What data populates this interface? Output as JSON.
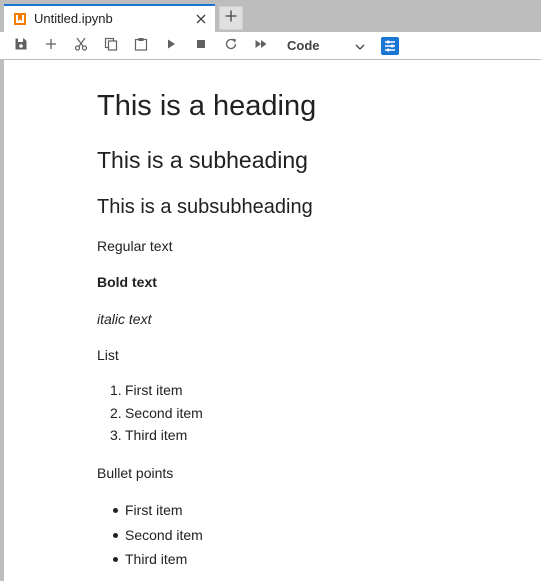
{
  "tab": {
    "title": "Untitled.ipynb",
    "icon": "notebook-icon",
    "accent_color": "#1976d2",
    "icon_color": "#f57c00"
  },
  "toolbar": {
    "buttons": [
      {
        "icon": "save-icon"
      },
      {
        "icon": "add-cell-icon"
      },
      {
        "icon": "cut-icon"
      },
      {
        "icon": "copy-icon"
      },
      {
        "icon": "paste-icon"
      },
      {
        "icon": "run-icon"
      },
      {
        "icon": "stop-icon"
      },
      {
        "icon": "restart-icon"
      },
      {
        "icon": "run-all-icon"
      }
    ],
    "cell_type": "Code",
    "inspector_icon": "property-inspector-icon"
  },
  "notebook": {
    "heading": "This is a heading",
    "subheading": "This is a subheading",
    "subsubheading": "This is a subsubheading",
    "regular": "Regular text",
    "bold": "Bold text",
    "italic": "italic text",
    "list_title": "List",
    "ordered": [
      {
        "marker": "1.",
        "text": "First item"
      },
      {
        "marker": "2.",
        "text": "Second item"
      },
      {
        "marker": "3.",
        "text": "Third item"
      }
    ],
    "bullets_title": "Bullet points",
    "bullets": [
      {
        "text": "First item"
      },
      {
        "text": "Second item"
      },
      {
        "text": "Third item"
      }
    ]
  }
}
